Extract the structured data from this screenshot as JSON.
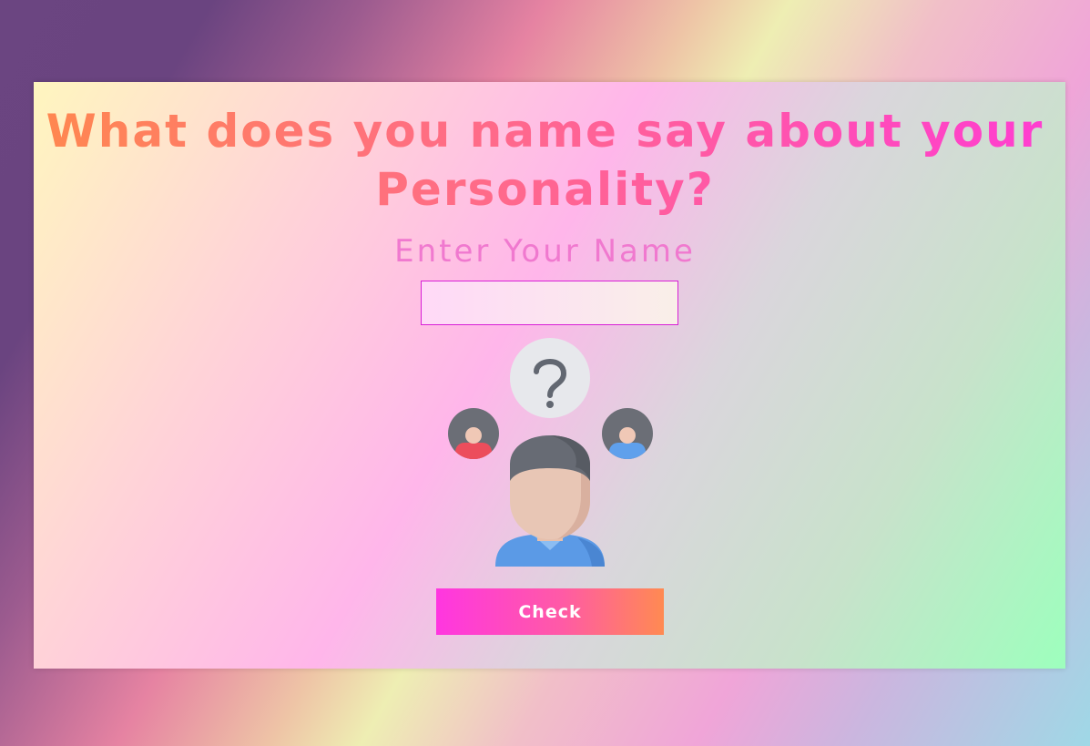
{
  "page": {
    "title": "What does you name say about your Personality?",
    "input_label": "Enter Your Name",
    "name_input": {
      "value": "",
      "placeholder": ""
    },
    "illustration": {
      "icon": "person-question-icon",
      "parts": [
        "question-mark-icon",
        "avatar-red-icon",
        "avatar-blue-icon",
        "thinking-person-icon"
      ]
    },
    "check_button_label": "Check"
  },
  "colors": {
    "title_gradient": [
      "#ff8a4a",
      "#ff3ad6"
    ],
    "label": "#f079cf",
    "input_border": "#d81fd6",
    "button_gradient": [
      "#ff36e0",
      "#ff8a52"
    ],
    "button_text": "#ffffff"
  }
}
